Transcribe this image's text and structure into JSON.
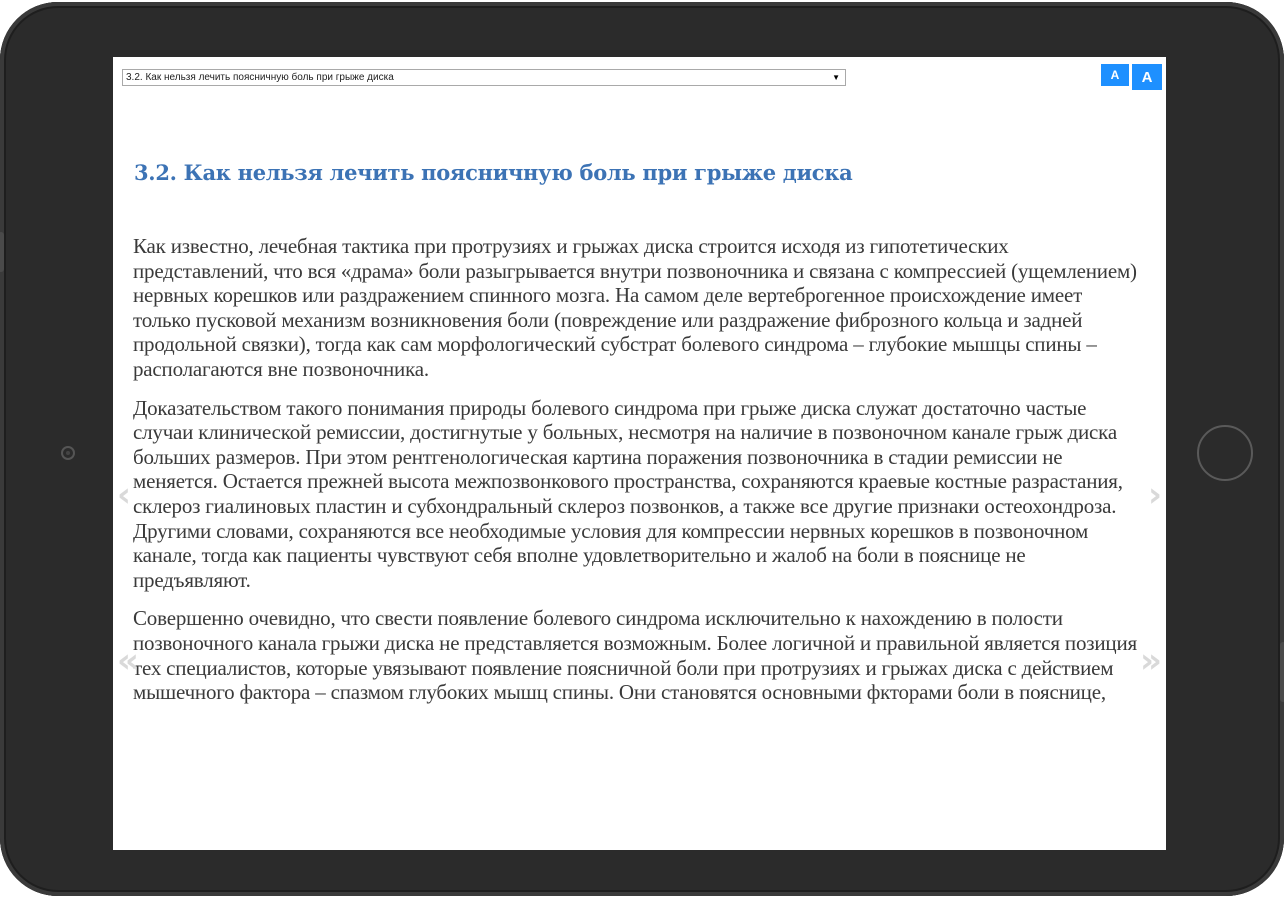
{
  "reader": {
    "chapter_select": {
      "selected": "3.2. Как нельзя лечить поясничную боль при грыже диска",
      "arrow_icon": "▼"
    },
    "font_controls": {
      "decrease_label": "A",
      "increase_label": "A",
      "accent_color": "#1e90ff"
    },
    "chapter_title": "3.2. Как нельзя лечить поясничную боль при грыже диска",
    "title_color": "#3c73b5",
    "paragraphs": [
      "Как известно, лечебная тактика при протрузиях и грыжах диска строится исходя из гипотетических представлений, что вся «драма» боли разыгрывается внутри позвоночника и связана с компрессией (ущемлением) нервных корешков или раздражением спинного мозга. На самом деле вертеброгенное происхождение имеет только пусковой механизм возникновения боли (повреждение или раздражение фиброзного кольца и задней продольной связки), тогда как сам морфологический субстрат болевого синдрома – глубокие мышцы спины – располагаются вне позвоночника.",
      "Доказательством такого понимания природы болевого синдрома при грыже диска служат достаточно частые случаи клинической ремиссии, достигнутые у больных, несмотря на наличие в позвоночном канале грыж диска больших размеров. При этом рентгенологическая картина поражения позвоночника в стадии ремиссии не меняется. Остается прежней высота межпозвонкового пространства, сохраняются краевые костные разрастания, склероз гиалиновых пластин и субхондральный склероз позвонков, а также все другие признаки остеохондроза. Другими словами, сохраняются все необходимые условия для компрессии нервных корешков в позвоночном канале, тогда как пациенты чувствуют себя вполне удовлетворительно и жалоб на боли в пояснице не предъявляют.",
      "Совершенно очевидно, что свести появление болевого синдрома исключительно к нахождению в полости позвоночного канала грыжи диска не представляется возможным. Более логичной и правильной является позиция тех специалистов, которые увязывают появление поясничной боли при протрузиях и грыжах диска с действием мышечного фактора – спазмом глубоких мышц спины. Они становятся основными фкторами  боли в пояснице,"
    ],
    "navigation": {
      "prev_page_icon": "‹",
      "next_page_icon": "›",
      "prev_chapter_icon": "«",
      "next_chapter_icon": "»"
    }
  }
}
